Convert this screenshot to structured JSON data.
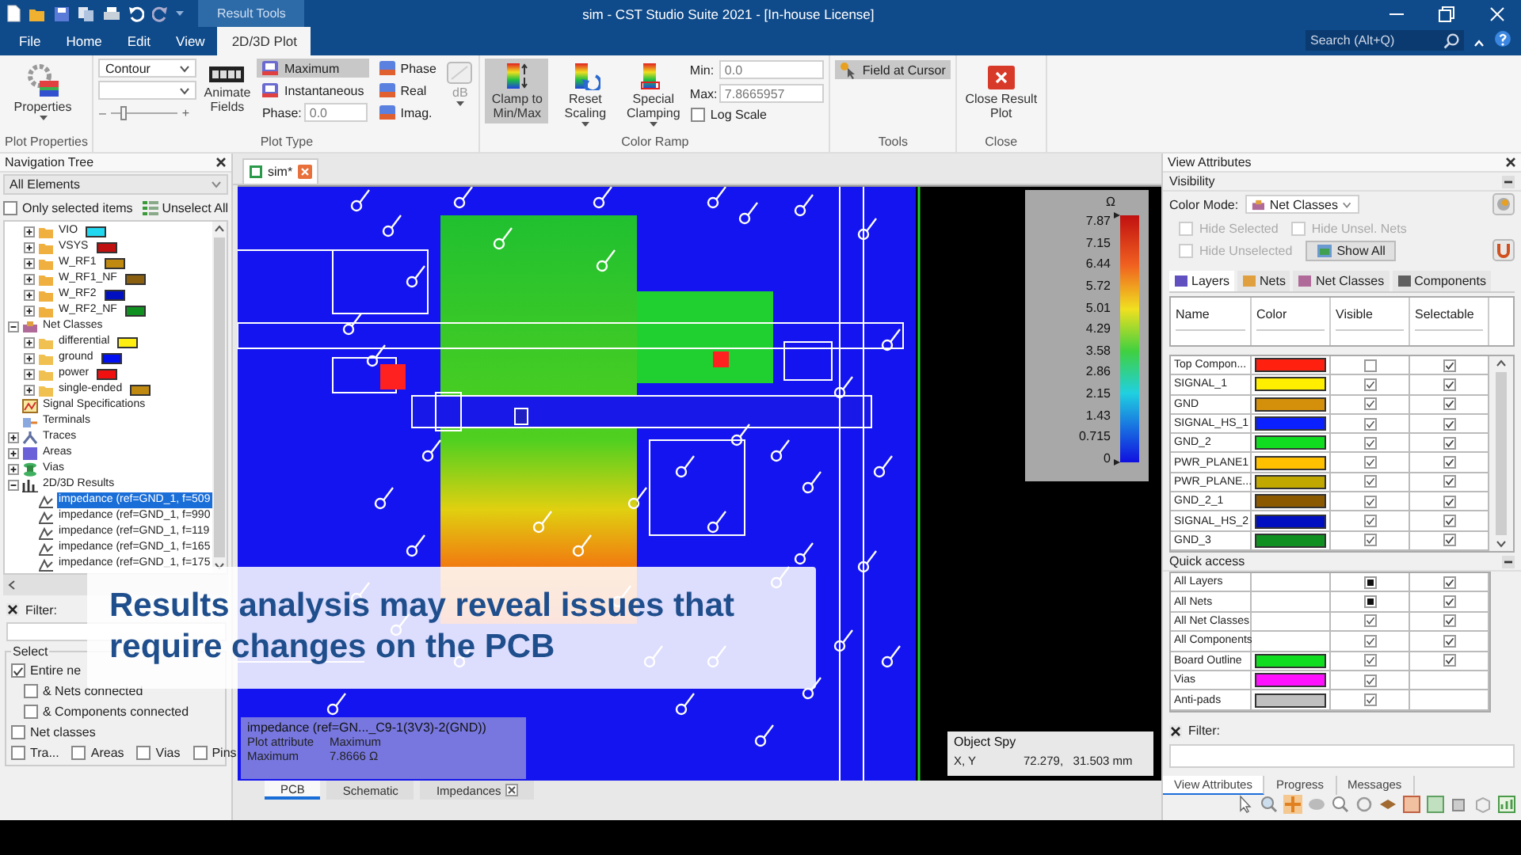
{
  "window": {
    "title": "sim - CST Studio Suite 2021 - [In-house License]",
    "context_tab": "Result Tools",
    "search_placeholder": "Search (Alt+Q)"
  },
  "menu_tabs": [
    {
      "label": "File",
      "selected": false
    },
    {
      "label": "Home",
      "selected": false
    },
    {
      "label": "Edit",
      "selected": false
    },
    {
      "label": "View",
      "selected": false
    },
    {
      "label": "2D/3D Plot",
      "selected": true
    }
  ],
  "ribbon": {
    "plot_properties": {
      "label": "Plot Properties",
      "button": "Properties"
    },
    "plot_type": {
      "label": "Plot Type",
      "plot_style": "Contour",
      "slider_minus": "–",
      "slider_plus": "+",
      "slider": {
        "level": 0.2
      },
      "animate_button": "Animate Fields",
      "modes": [
        {
          "label": "Maximum",
          "selected": true
        },
        {
          "label": "Instantaneous",
          "selected": false
        }
      ],
      "phase_label": "Phase:",
      "phase_value": "0.0",
      "parts": [
        {
          "label": "Phase"
        },
        {
          "label": "Real"
        },
        {
          "label": "Imag."
        }
      ],
      "db_button": "dB",
      "db_disabled": true
    },
    "color_ramp": {
      "label": "Color Ramp",
      "buttons": [
        {
          "kind": "clamp",
          "label": "Clamp to Min/Max",
          "selected": true,
          "dropdown": false
        },
        {
          "kind": "reset",
          "label": "Reset Scaling",
          "selected": false,
          "dropdown": true
        },
        {
          "kind": "special",
          "label": "Special Clamping",
          "selected": false,
          "dropdown": true
        }
      ],
      "min_label": "Min:",
      "min_value": "0.0",
      "max_label": "Max:",
      "max_value": "7.8665957",
      "log_scale": {
        "label": "Log Scale",
        "checked": false
      }
    },
    "tools": {
      "label": "Tools",
      "button": "Field at Cursor",
      "selected": true
    },
    "close": {
      "label": "Close",
      "button": "Close Result Plot"
    }
  },
  "navigation_tree": {
    "title": "Navigation Tree",
    "filter_dropdown": "All Elements",
    "only_selected": {
      "label": "Only selected items",
      "checked": false
    },
    "unselect_all": "Unselect All",
    "scrolled_children": [
      {
        "kind": "net",
        "label": "VIO",
        "color": "#20d8f0",
        "expanded": false
      },
      {
        "kind": "net",
        "label": "VSYS",
        "color": "#c01010",
        "expanded": false
      },
      {
        "kind": "net",
        "label": "W_RF1",
        "color": "#c08a10",
        "expanded": false
      },
      {
        "kind": "net",
        "label": "W_RF1_NF",
        "color": "#8a6010",
        "expanded": false
      },
      {
        "kind": "net",
        "label": "W_RF2",
        "color": "#0010c0",
        "expanded": false
      },
      {
        "kind": "net",
        "label": "W_RF2_NF",
        "color": "#109020",
        "expanded": false
      }
    ],
    "items": [
      {
        "kind": "netclasses",
        "label": "Net Classes",
        "expanded": true,
        "children": [
          {
            "kind": "netclass",
            "label": "differential",
            "color": "#ffee10",
            "expanded": false
          },
          {
            "kind": "netclass",
            "label": "ground",
            "color": "#0010f0",
            "expanded": false
          },
          {
            "kind": "netclass",
            "label": "power",
            "color": "#f01010",
            "expanded": false
          },
          {
            "kind": "netclass",
            "label": "single-ended",
            "color": "#c08a10",
            "expanded": false
          }
        ]
      },
      {
        "kind": "signals",
        "label": "Signal Specifications"
      },
      {
        "kind": "terminals",
        "label": "Terminals"
      },
      {
        "kind": "traces",
        "label": "Traces",
        "expanded": false
      },
      {
        "kind": "areas",
        "label": "Areas",
        "expanded": false
      },
      {
        "kind": "vias",
        "label": "Vias",
        "expanded": false
      },
      {
        "kind": "results",
        "label": "2D/3D Results",
        "expanded": true,
        "children": [
          {
            "kind": "impedance",
            "label": "impedance (ref=GND_1, f=509",
            "selected": true
          },
          {
            "kind": "impedance",
            "label": "impedance (ref=GND_1, f=990",
            "selected": false
          },
          {
            "kind": "impedance",
            "label": "impedance (ref=GND_1, f=119",
            "selected": false
          },
          {
            "kind": "impedance",
            "label": "impedance (ref=GND_1, f=165",
            "selected": false
          },
          {
            "kind": "impedance",
            "label": "impedance (ref=GND_1, f=175",
            "selected": false
          }
        ]
      }
    ],
    "filter_label": "Filter:",
    "select": {
      "label": "Select",
      "entire": {
        "label": "Entire ne",
        "checked": true
      },
      "connected": [
        {
          "label": "& Nets connected",
          "checked": false
        },
        {
          "label": "& Components connected",
          "checked": false
        }
      ],
      "net_classes": {
        "label": "Net classes",
        "checked": false
      },
      "types": [
        {
          "label": "Tra...",
          "checked": false
        },
        {
          "label": "Areas",
          "checked": false
        },
        {
          "label": "Vias",
          "checked": false
        },
        {
          "label": "Pins",
          "checked": false
        }
      ]
    }
  },
  "editor": {
    "document_tab": "sim*",
    "legend": {
      "unit": "Ω",
      "ticks": [
        "7.87",
        "7.15",
        "6.44",
        "5.72",
        "5.01",
        "4.29",
        "3.58",
        "2.86",
        "2.15",
        "1.43",
        "0.715",
        "0"
      ]
    },
    "info": {
      "title": "impedance (ref=GN..._C9-1(3V3)-2(GND))",
      "rows": [
        {
          "label": "Plot attribute",
          "value": "Maximum"
        },
        {
          "label": "Maximum",
          "value": "7.8666 Ω"
        }
      ]
    },
    "object_spy": {
      "title": "Object Spy",
      "label": "X, Y",
      "value": "72.279,   31.503 mm"
    },
    "view_tabs": [
      {
        "label": "PCB",
        "selected": true,
        "closable": false
      },
      {
        "label": "Schematic",
        "selected": false,
        "closable": false
      },
      {
        "label": "Impedances",
        "selected": false,
        "closable": true
      }
    ]
  },
  "caption": "Results analysis may reveal issues that require changes on the PCB",
  "view_attributes": {
    "title": "View Attributes",
    "visibility_label": "Visibility",
    "color_mode_label": "Color Mode:",
    "color_mode": "Net Classes",
    "options": [
      {
        "label": "Hide Selected",
        "checked": false,
        "disabled": true
      },
      {
        "label": "Hide Unsel. Nets",
        "checked": false,
        "disabled": true
      },
      {
        "label": "Hide Unselected",
        "checked": false,
        "disabled": true
      }
    ],
    "show_all": "Show All",
    "tabs": [
      {
        "label": "Layers",
        "selected": true
      },
      {
        "label": "Nets",
        "selected": false
      },
      {
        "label": "Net Classes",
        "selected": false
      },
      {
        "label": "Components",
        "selected": false
      }
    ],
    "columns": [
      "Name",
      "Color",
      "Visible",
      "Selectable"
    ],
    "layers": [
      {
        "name": "Top Compon...",
        "color": "#ff2010",
        "visible": false,
        "selectable": true
      },
      {
        "name": "SIGNAL_1",
        "color": "#ffee00",
        "visible": true,
        "selectable": true
      },
      {
        "name": "GND",
        "color": "#d4900a",
        "visible": true,
        "selectable": true
      },
      {
        "name": "SIGNAL_HS_1",
        "color": "#0a20ff",
        "visible": true,
        "selectable": true
      },
      {
        "name": "GND_2",
        "color": "#10dd20",
        "visible": true,
        "selectable": true
      },
      {
        "name": "PWR_PLANE1",
        "color": "#ffc000",
        "visible": true,
        "selectable": true
      },
      {
        "name": "PWR_PLANE...",
        "color": "#c0a800",
        "visible": true,
        "selectable": true
      },
      {
        "name": "GND_2_1",
        "color": "#8b5a00",
        "visible": true,
        "selectable": true
      },
      {
        "name": "SIGNAL_HS_2",
        "color": "#0010c0",
        "visible": true,
        "selectable": true
      },
      {
        "name": "GND_3",
        "color": "#109020",
        "visible": true,
        "selectable": true
      }
    ],
    "quick_access_label": "Quick access",
    "quick_access": [
      {
        "name": "All Layers",
        "visible": true,
        "mixed": true,
        "selectable": true
      },
      {
        "name": "All Nets",
        "visible": true,
        "mixed": true,
        "selectable": true
      },
      {
        "name": "All Net Classes",
        "visible": true,
        "mixed": false,
        "selectable": true
      },
      {
        "name": "All Components",
        "visible": true,
        "mixed": false,
        "selectable": true
      },
      {
        "name": "Board Outline",
        "color": "#10dd20",
        "visible": true,
        "mixed": false,
        "selectable": true
      },
      {
        "name": "Vias",
        "color": "#ff10ff",
        "visible": true,
        "mixed": false
      },
      {
        "name": "Anti-pads",
        "color": "#c0c0c0",
        "visible": true,
        "mixed": false
      }
    ],
    "filter_label": "Filter:"
  },
  "bottom_tabs": [
    {
      "label": "View Attributes",
      "selected": true
    },
    {
      "label": "Progress",
      "selected": false
    },
    {
      "label": "Messages",
      "selected": false
    }
  ]
}
